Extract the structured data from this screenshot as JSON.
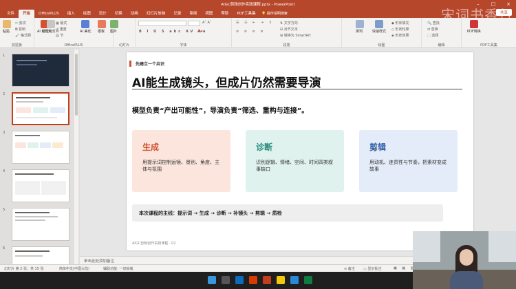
{
  "window": {
    "title": "AIGC剪辑创作实践课程.pptx - PowerPoint",
    "watermark": "宋词书香行"
  },
  "tabs": [
    "文件",
    "开始",
    "OfficePLUS",
    "插入",
    "绘图",
    "设计",
    "切换",
    "动画",
    "幻灯片放映",
    "记录",
    "审阅",
    "视图",
    "帮助",
    "PDF工具集"
  ],
  "active_tab": "开始",
  "search_hint": "操作说明搜索",
  "share_label": "共享",
  "ribbon": {
    "groups": [
      {
        "name": "剪贴板",
        "buttons": [
          "粘贴",
          "剪切",
          "复制",
          "格式刷"
        ]
      },
      {
        "name": "OfficePLUS",
        "buttons": [
          "AI 幻灯片",
          "AI 美化",
          "模板",
          "图片"
        ]
      },
      {
        "name": "幻灯片",
        "buttons": [
          "新建幻灯片",
          "版式",
          "重置",
          "节"
        ]
      },
      {
        "name": "字体",
        "buttons": []
      },
      {
        "name": "段落",
        "buttons": [
          "文字方向",
          "对齐文本",
          "转换为 SmartArt"
        ]
      },
      {
        "name": "绘图",
        "buttons": [
          "排列",
          "快速样式",
          "形状填充",
          "形状轮廓",
          "形状效果"
        ]
      },
      {
        "name": "编辑",
        "buttons": [
          "查找",
          "替换",
          "选择"
        ]
      },
      {
        "name": "PDF工具集",
        "buttons": [
          "PDF转换"
        ]
      }
    ]
  },
  "thumbnails": [
    "1",
    "2",
    "3",
    "4",
    "5",
    "6"
  ],
  "slide": {
    "kicker": "先建立一个共识",
    "headline": "AI能生成镜头，但成片仍然需要导演",
    "sub": "模型负责“产出可能性”，导演负责“筛选、重构与连接”。",
    "cards": [
      {
        "title": "生成",
        "body": "用提示词控制运镜、景别、角度、主体与氛围",
        "bg": "#fbe5dc",
        "color": "#d35230"
      },
      {
        "title": "诊断",
        "body": "识别逻辑、情绪、空间、时间四类叙事缺口",
        "bg": "#dff2ee",
        "color": "#2a8c7e"
      },
      {
        "title": "剪辑",
        "body": "用动机、连贯性与节奏，把素材变成故事",
        "bg": "#e3ecf8",
        "color": "#2f5fa8"
      }
    ],
    "flow": "本次课程的主线：提示词 → 生成 → 诊断 → 补镜头 → 剪辑 → 质检",
    "footer": "AIGC剪辑创作实践课程 · 02"
  },
  "notes_placeholder": "单击此处添加备注",
  "status": {
    "slide_info": "幻灯片 第 2 张，共 15 张",
    "language": "简体中文(中国大陆)",
    "accessibility": "辅助功能: 一切就绪",
    "notes": "备注",
    "comments": "显示批注",
    "zoom": "93%"
  }
}
